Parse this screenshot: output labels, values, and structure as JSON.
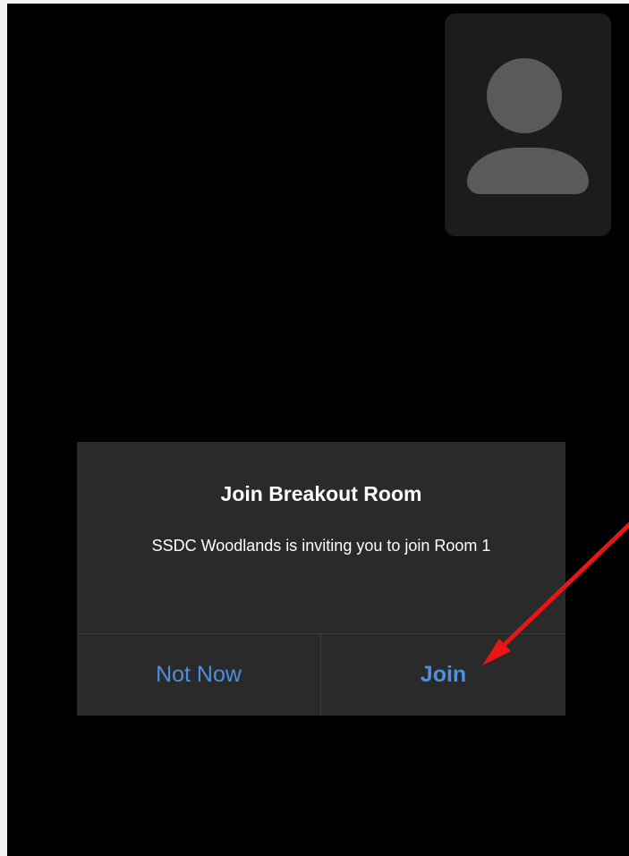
{
  "self_view": {
    "avatar_icon": "person-icon"
  },
  "dialog": {
    "title": "Join Breakout Room",
    "message": "SSDC Woodlands is inviting you to join Room 1",
    "secondary_button": "Not Now",
    "primary_button": "Join"
  },
  "colors": {
    "background": "#000000",
    "dialog_background": "#2a2a2a",
    "button_text": "#4d8fe0",
    "annotation_arrow": "#e81616"
  }
}
